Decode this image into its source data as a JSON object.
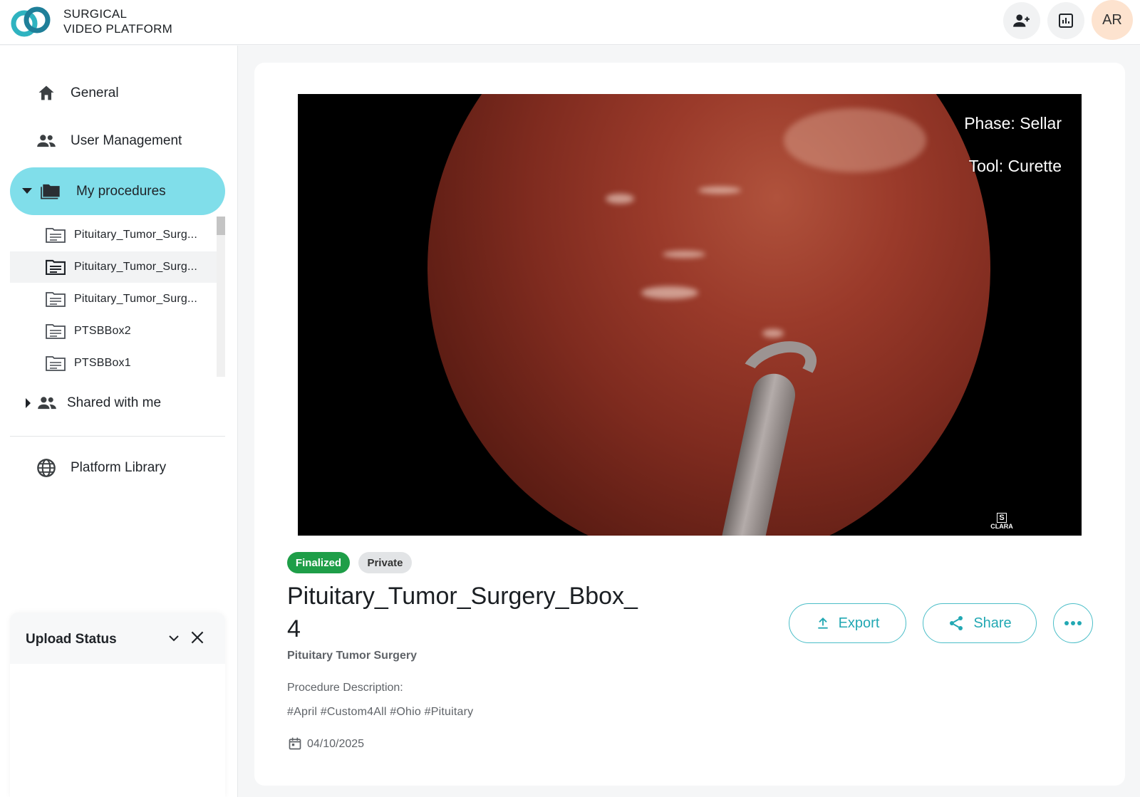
{
  "header": {
    "brand_line1": "SURGICAL",
    "brand_line2": "VIDEO PLATFORM",
    "avatar_initials": "AR",
    "icons": [
      "add-user-icon",
      "analytics-icon"
    ]
  },
  "sidebar": {
    "general": "General",
    "user_management": "User Management",
    "my_procedures": "My procedures",
    "procedures": [
      {
        "label": "Pituitary_Tumor_Surg...",
        "selected": false
      },
      {
        "label": "Pituitary_Tumor_Surg...",
        "selected": true
      },
      {
        "label": "Pituitary_Tumor_Surg...",
        "selected": false
      },
      {
        "label": "PTSBBox2",
        "selected": false
      },
      {
        "label": "PTSBBox1",
        "selected": false
      }
    ],
    "shared_with_me": "Shared with me",
    "platform_library": "Platform Library",
    "upload_status": "Upload Status"
  },
  "video": {
    "phase_label": "Phase:",
    "phase_value": "Sellar",
    "tool_label": "Tool:",
    "tool_value": "Curette",
    "watermark": "CLARA",
    "watermark_letter": "S"
  },
  "procedure": {
    "status_badge": "Finalized",
    "visibility_badge": "Private",
    "title": "Pituitary_Tumor_Surgery_Bbox_4",
    "subtitle": "Pituitary Tumor Surgery",
    "description_label": "Procedure Description:",
    "tags": "#April #Custom4All #Ohio #Pituitary",
    "date": "04/10/2025"
  },
  "actions": {
    "export": "Export",
    "share": "Share"
  },
  "colors": {
    "accent": "#22a8b3",
    "selected_nav": "#80deea",
    "finalized": "#1e9e48",
    "avatar_bg": "#fde3cf"
  }
}
